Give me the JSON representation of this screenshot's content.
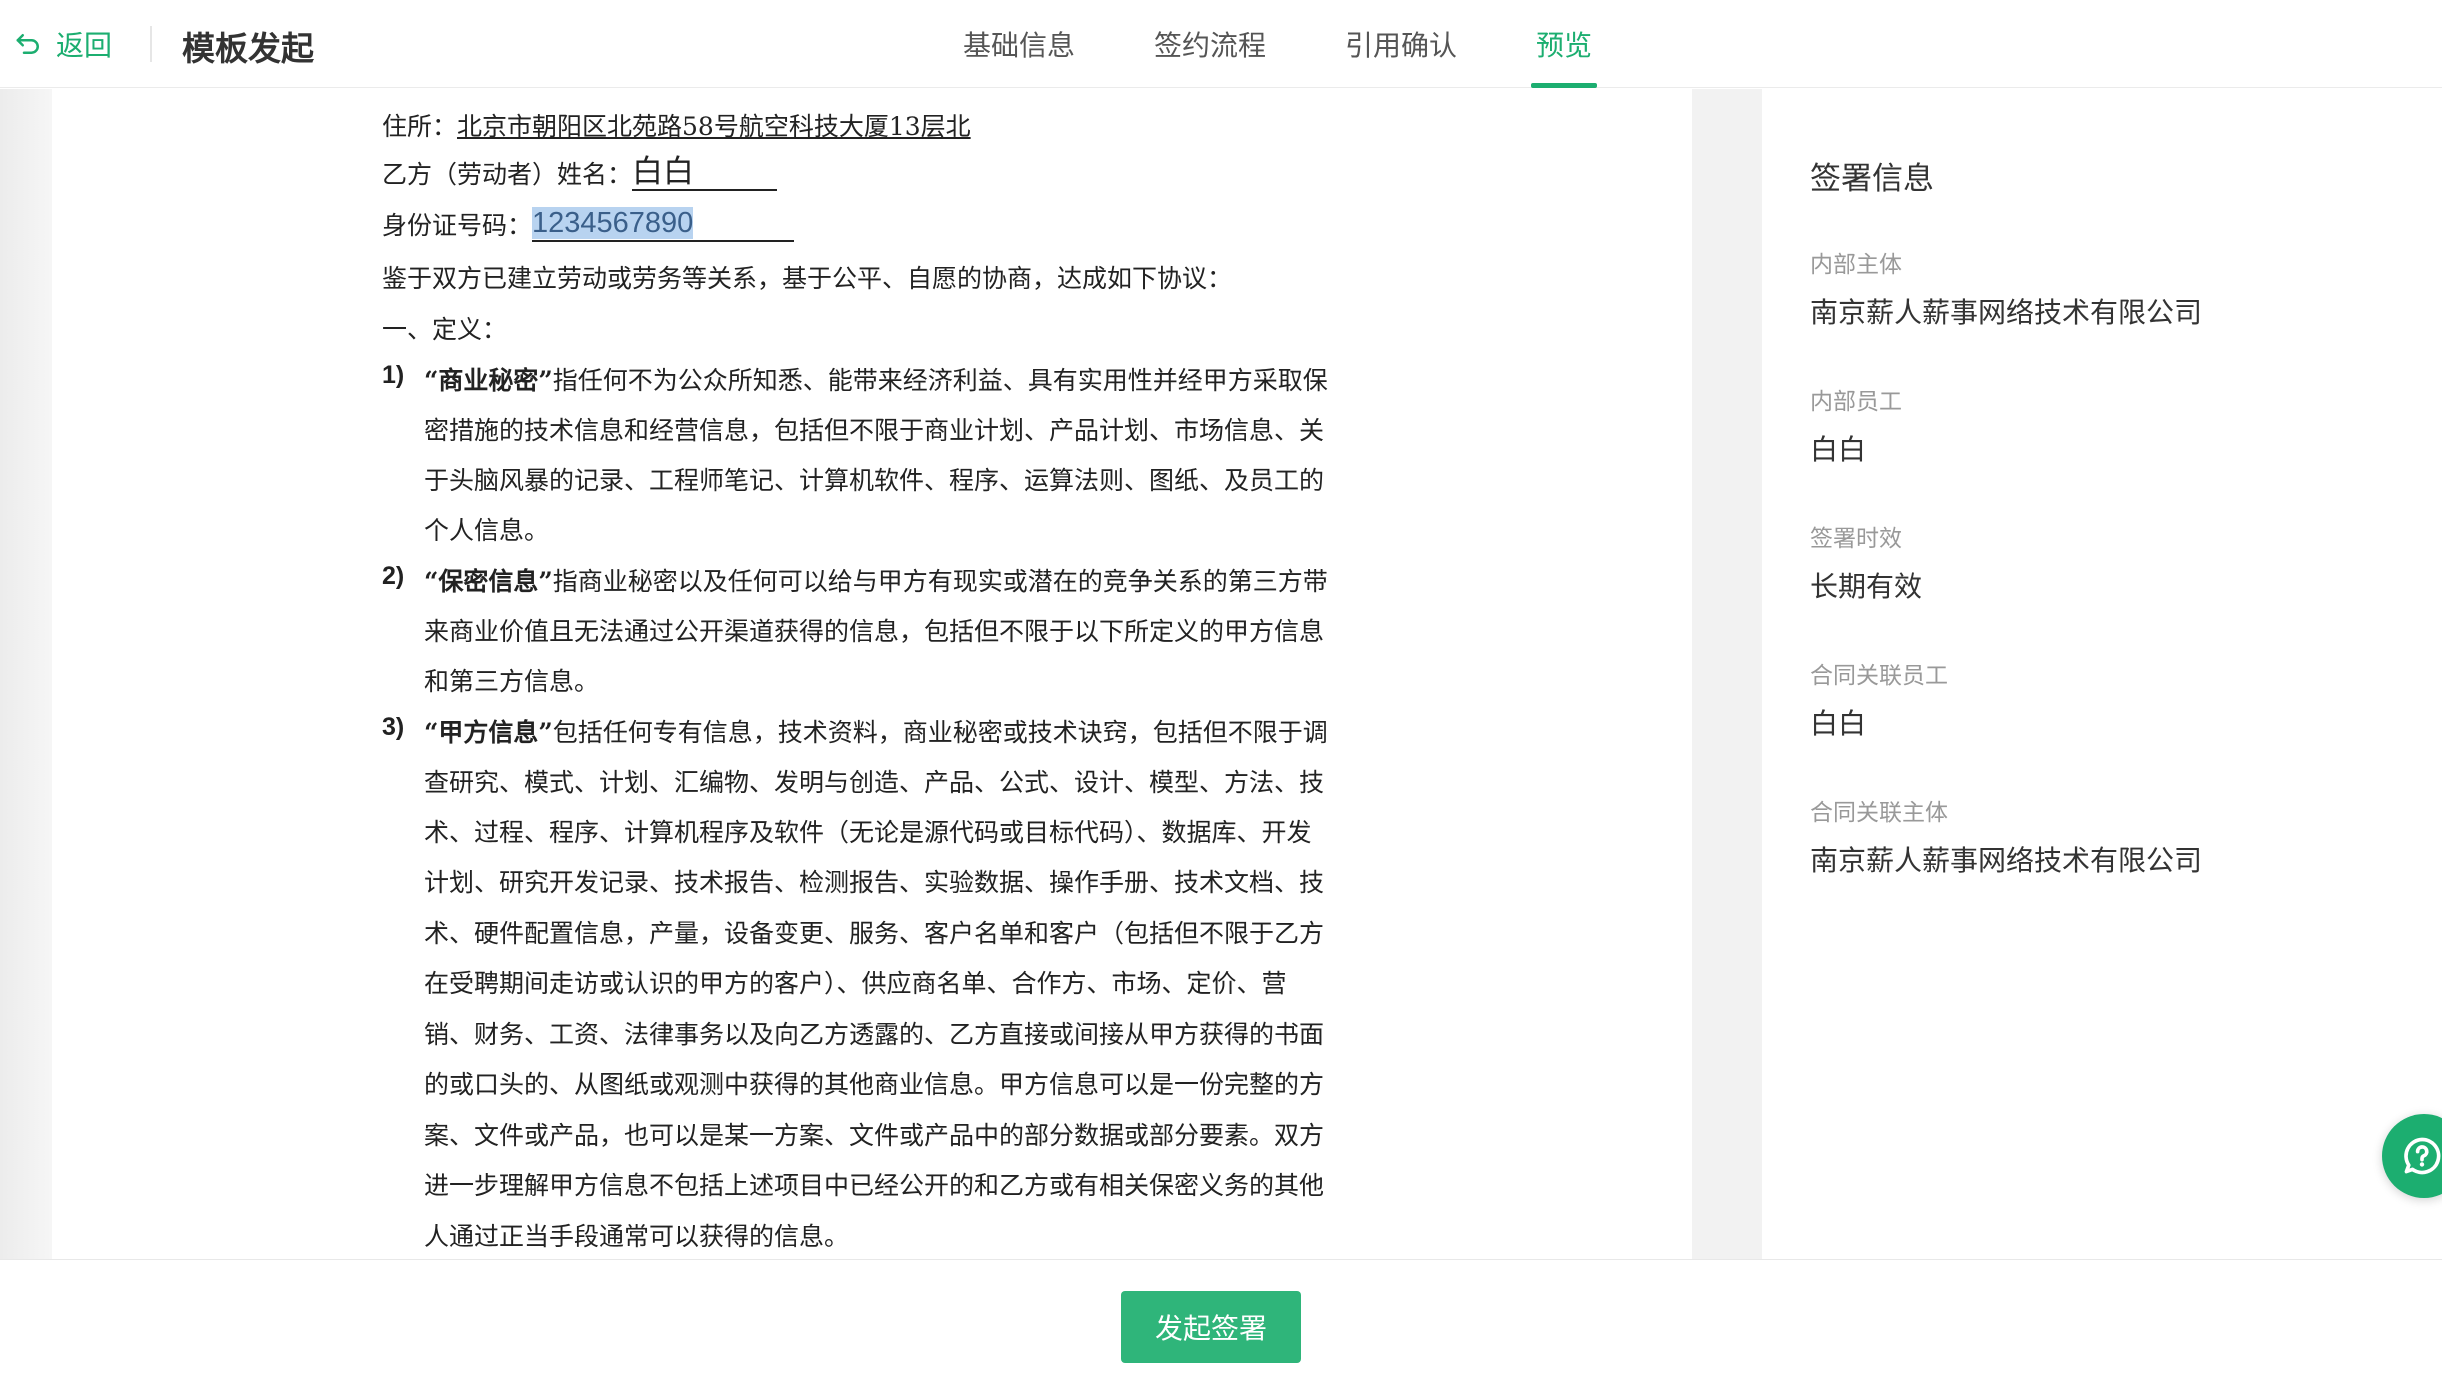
{
  "header": {
    "back_label": "返回",
    "title": "模板发起",
    "tabs": [
      {
        "label": "基础信息",
        "active": false
      },
      {
        "label": "签约流程",
        "active": false
      },
      {
        "label": "引用确认",
        "active": false
      },
      {
        "label": "预览",
        "active": true
      }
    ]
  },
  "document": {
    "address_label": "住所：",
    "address_value": "北京市朝阳区北苑路58号航空科技大厦13层北",
    "name_label": "乙方（劳动者）姓名：",
    "name_value": "白白",
    "id_label": "身份证号码：",
    "id_value": "1234567890",
    "intro": "鉴于双方已建立劳动或劳务等关系，基于公平、自愿的协商，达成如下协议：",
    "section_title": "一、定义：",
    "items": [
      {
        "num": "1)",
        "term": "“商业秘密”",
        "lines": [
          "指任何不为公众所知悉、能带来经济利益、具有实用性并经甲方采取保",
          "密措施的技术信息和经营信息，包括但不限于商业计划、产品计划、市场信息、关",
          "于头脑风暴的记录、工程师笔记、计算机软件、程序、运算法则、图纸、及员工的",
          "个人信息。"
        ]
      },
      {
        "num": "2)",
        "term": "“保密信息”",
        "lines": [
          "指商业秘密以及任何可以给与甲方有现实或潜在的竞争关系的第三方带",
          "来商业价值且无法通过公开渠道获得的信息，包括但不限于以下所定义的甲方信息",
          "和第三方信息。"
        ]
      },
      {
        "num": "3)",
        "term": "“甲方信息”",
        "lines": [
          "包括任何专有信息，技术资料，商业秘密或技术诀窍，包括但不限于调",
          "查研究、模式、计划、汇编物、发明与创造、产品、公式、设计、模型、方法、技",
          "术、过程、程序、计算机程序及软件（无论是源代码或目标代码）、数据库、开发",
          "计划、研究开发记录、技术报告、检测报告、实验数据、操作手册、技术文档、技",
          "术、硬件配置信息，产量，设备变更、服务、客户名单和客户（包括但不限于乙方",
          "在受聘期间走访或认识的甲方的客户）、供应商名单、合作方、市场、定价、营",
          "销、财务、工资、法律事务以及向乙方透露的、乙方直接或间接从甲方获得的书面",
          "的或口头的、从图纸或观测中获得的其他商业信息。甲方信息可以是一份完整的方",
          "案、文件或产品，也可以是某一方案、文件或产品中的部分数据或部分要素。双方",
          "进一步理解甲方信息不包括上述项目中已经公开的和乙方或有相关保密义务的其他",
          "人通过正当手段通常可以获得的信息。"
        ]
      }
    ]
  },
  "side": {
    "title": "签署信息",
    "fields": [
      {
        "label": "内部主体",
        "value": "南京薪人薪事网络技术有限公司"
      },
      {
        "label": "内部员工",
        "value": "白白"
      },
      {
        "label": "签署时效",
        "value": "长期有效"
      },
      {
        "label": "合同关联员工",
        "value": "白白"
      },
      {
        "label": "合同关联主体",
        "value": "南京薪人薪事网络技术有限公司"
      }
    ]
  },
  "footer": {
    "submit_label": "发起签署"
  },
  "colors": {
    "accent": "#1cae70",
    "button": "#2fb57a",
    "highlight": "#b8d3f0"
  },
  "icons": {
    "back": "undo-arrow-icon",
    "help": "question-bubble-icon"
  }
}
